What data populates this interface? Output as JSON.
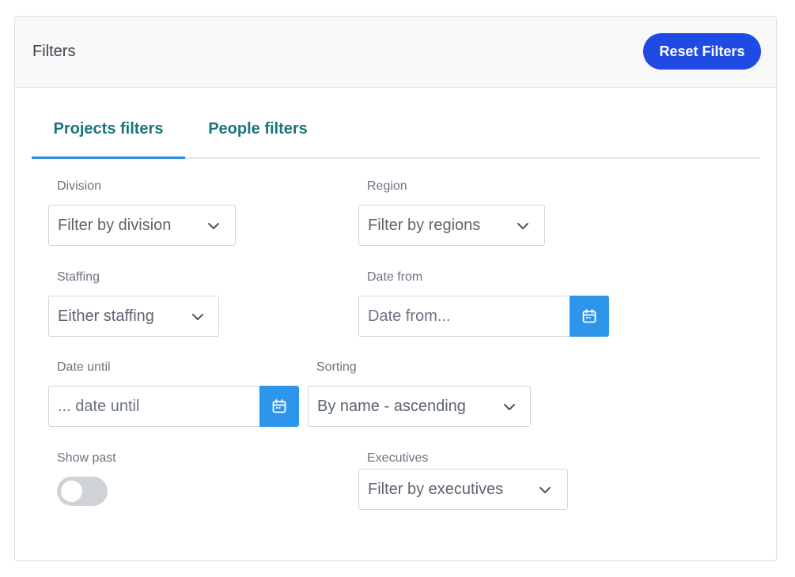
{
  "header": {
    "title": "Filters",
    "reset_label": "Reset Filters",
    "reset_color": "#1f4be4"
  },
  "tabs": [
    {
      "label": "Projects filters",
      "active": true
    },
    {
      "label": "People filters",
      "active": false
    }
  ],
  "fields": {
    "division": {
      "label": "Division",
      "value": "Filter by division",
      "icon": "chevron-down-icon"
    },
    "region": {
      "label": "Region",
      "value": "Filter by regions",
      "icon": "chevron-down-icon"
    },
    "staffing": {
      "label": "Staffing",
      "value": "Either staffing",
      "icon": "chevron-down-icon"
    },
    "date_from": {
      "label": "Date from",
      "placeholder": "Date from...",
      "icon": "calendar-icon"
    },
    "date_until": {
      "label": "Date until",
      "placeholder": "... date until",
      "icon": "calendar-icon"
    },
    "sorting": {
      "label": "Sorting",
      "value": "By name - ascending",
      "icon": "chevron-down-icon"
    },
    "show_past": {
      "label": "Show past",
      "on": false
    },
    "executives": {
      "label": "Executives",
      "value": "Filter by executives",
      "icon": "chevron-down-icon"
    }
  },
  "colors": {
    "tab_text": "#17767a",
    "tab_active_bar": "#2b8fd8",
    "calendar_button": "#2e96ea",
    "toggle_off": "#cfd3d8"
  }
}
